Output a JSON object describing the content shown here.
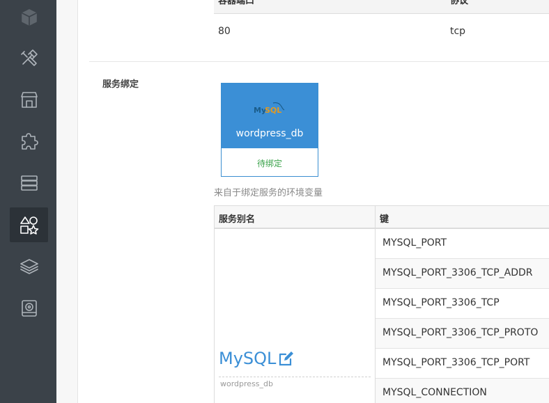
{
  "sidebar": {
    "items": [
      {
        "icon": "cube-icon"
      },
      {
        "icon": "tools-icon"
      },
      {
        "icon": "store-icon"
      },
      {
        "icon": "puzzle-icon"
      },
      {
        "icon": "server-icon"
      },
      {
        "icon": "shapes-icon",
        "active": true
      },
      {
        "icon": "layers-icon"
      },
      {
        "icon": "disk-icon"
      }
    ]
  },
  "ports": {
    "columns": [
      "容器端口",
      "协议"
    ],
    "rows": [
      {
        "port": "80",
        "protocol": "tcp"
      }
    ]
  },
  "binding": {
    "label": "服务绑定",
    "card": {
      "logo_text": "MySQL",
      "name": "wordpress_db",
      "status": "待绑定"
    },
    "env_caption": "来自于绑定服务的环境变量",
    "table": {
      "columns": [
        "服务别名",
        "键"
      ],
      "alias": "MySQL",
      "alias_sub": "wordpress_db",
      "keys": [
        "MYSQL_PORT",
        "MYSQL_PORT_3306_TCP_ADDR",
        "MYSQL_PORT_3306_TCP",
        "MYSQL_PORT_3306_TCP_PROTO",
        "MYSQL_PORT_3306_TCP_PORT",
        "MYSQL_CONNECTION"
      ]
    }
  },
  "colors": {
    "sidebar_bg": "#3b4249",
    "accent": "#3b8fd6",
    "status_green": "#3aa24a"
  }
}
